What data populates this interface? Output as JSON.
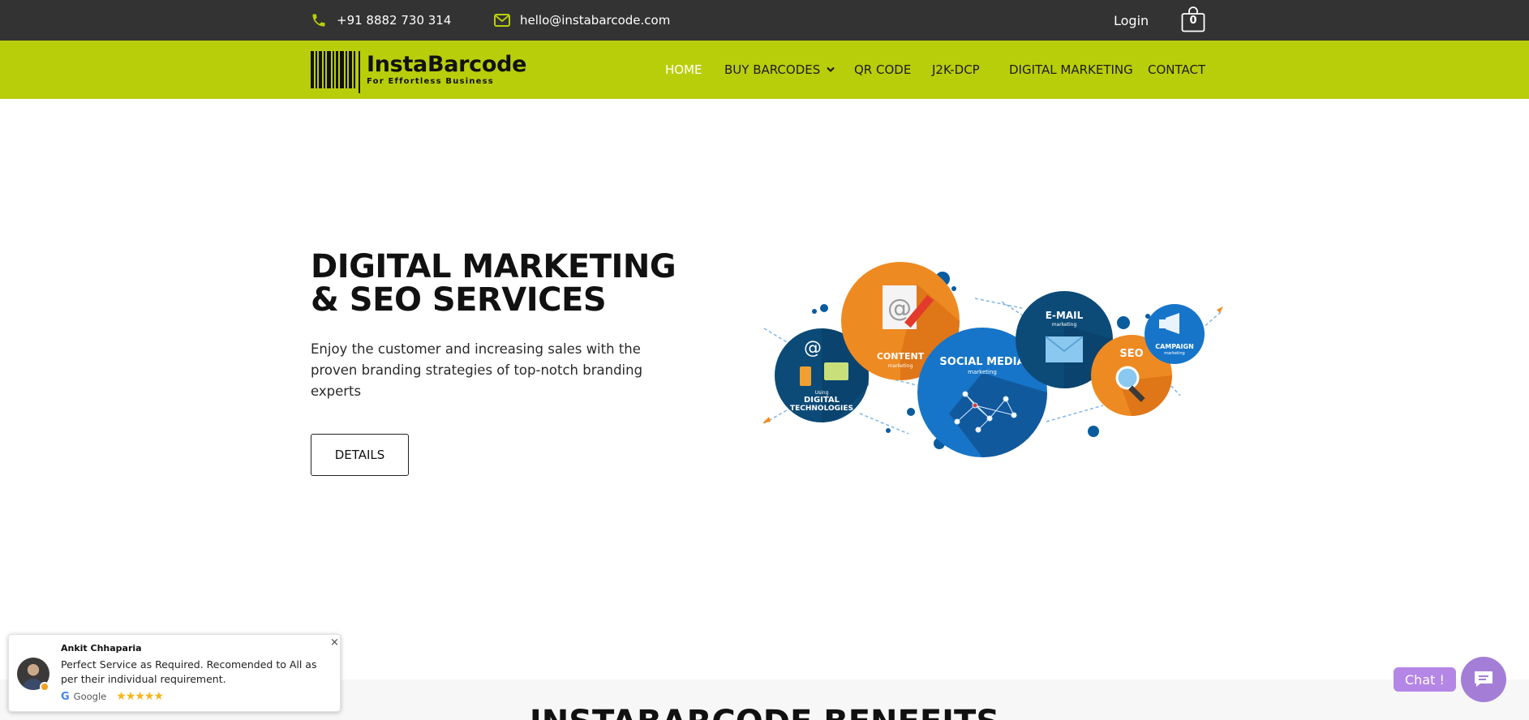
{
  "topbar": {
    "phone": "+91 8882 730 314",
    "email": "hello@instabarcode.com",
    "login_label": "Login",
    "cart_count": "0"
  },
  "brand": {
    "name": "InstaBarcode",
    "tagline": "For Effortless Business"
  },
  "nav": {
    "items": [
      {
        "label": "HOME",
        "active": true
      },
      {
        "label": "BUY BARCODES",
        "has_dropdown": true
      },
      {
        "label": "QR CODE"
      },
      {
        "label": "J2K-DCP"
      },
      {
        "label": "DIGITAL MARKETING"
      },
      {
        "label": "CONTACT"
      }
    ]
  },
  "hero": {
    "title": "DIGITAL MARKETING & SEO SERVICES",
    "description": "Enjoy the customer and increasing sales with the proven branding strategies of top-notch branding experts",
    "button_label": "DETAILS"
  },
  "illustration": {
    "labels": {
      "digital_main": "DIGITAL",
      "digital_sub": "TECHNOLOGIES",
      "digital_using": "Using",
      "content": "CONTENT",
      "content_sub": "marketing",
      "social": "SOCIAL MEDIA",
      "social_sub": "marketing",
      "email": "E-MAIL",
      "email_sub": "marketing",
      "seo": "SEO",
      "campaign": "CAMPAIGN",
      "campaign_sub": "marketing"
    }
  },
  "benefits": {
    "title": "INSTABARCODE BENEFITS"
  },
  "review": {
    "name": "Ankit Chhaparia",
    "text": "Perfect Service as Required. Recomended to All as per their individual requirement.",
    "source": "Google",
    "stars": "★★★★★",
    "close": "×"
  },
  "chat": {
    "label": "Chat !"
  },
  "colors": {
    "topbar_bg": "#333333",
    "brand_green": "#b9ce0a",
    "chat_purple": "#a47ed6"
  }
}
